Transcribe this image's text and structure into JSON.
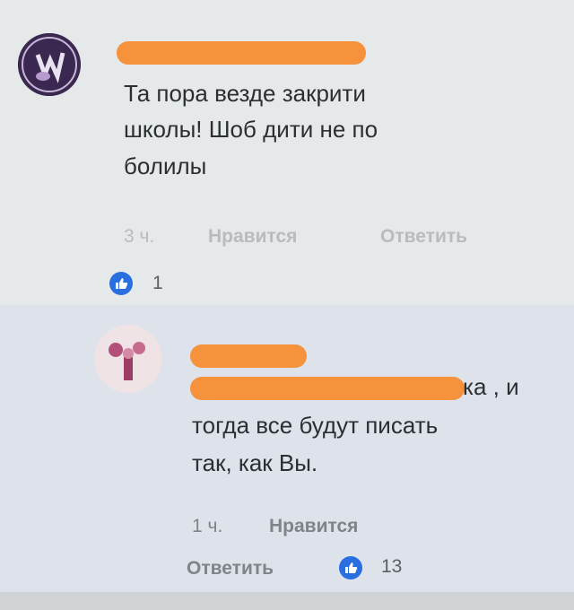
{
  "comments": [
    {
      "text_lines": [
        "Та пора везде закрити",
        "школы! Шоб дити не по",
        "болилы"
      ],
      "time": "3 ч.",
      "like_label": "Нравится",
      "reply_label": "Ответить",
      "likes": "1"
    },
    {
      "text_line1_end": "ка , и",
      "text_lines": [
        "тогда все будут писать",
        "так, как Вы."
      ],
      "time": "1 ч.",
      "like_label": "Нравится",
      "reply_label": "Ответить",
      "likes": "13"
    }
  ],
  "colors": {
    "redaction": "#f5923b",
    "like_badge": "#2a6fe0"
  },
  "icons": {
    "like": "thumbs-up-icon"
  }
}
